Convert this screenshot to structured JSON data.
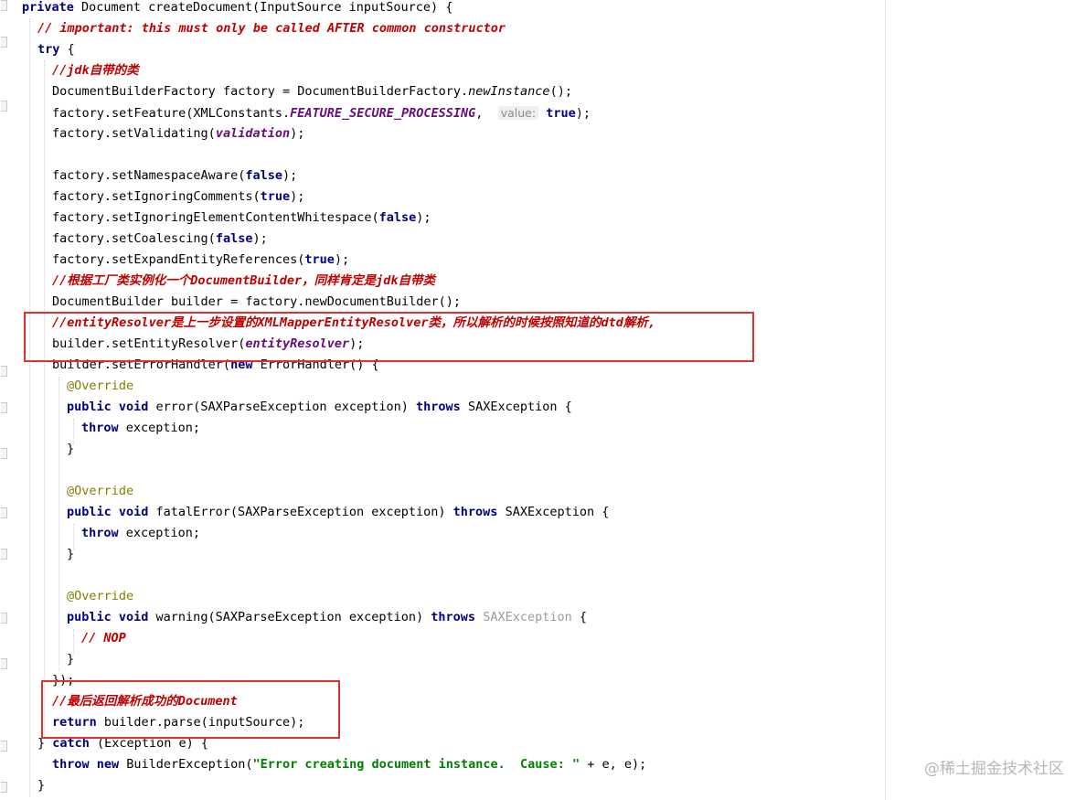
{
  "code_lines": [
    [
      {
        "t": "private ",
        "c": "kw"
      },
      {
        "t": "Document createDocument(InputSource inputSource) {"
      }
    ],
    [
      {
        "t": "// important: this must only be called AFTER common constructor",
        "c": "cm"
      }
    ],
    [
      {
        "t": "try ",
        "c": "kw"
      },
      {
        "t": "{"
      }
    ],
    [
      {
        "t": "//jdk自带的类",
        "c": "cm"
      }
    ],
    [
      {
        "t": "DocumentBuilderFactory factory = DocumentBuilderFactory."
      },
      {
        "t": "newInstance",
        "c": "mth"
      },
      {
        "t": "();"
      }
    ],
    [
      {
        "t": "factory.setFeature(XMLConstants."
      },
      {
        "t": "FEATURE_SECURE_PROCESSING",
        "c": "fld"
      },
      {
        "t": ",  "
      },
      {
        "t": "value:",
        "c": "hint"
      },
      {
        "t": " "
      },
      {
        "t": "true",
        "c": "kw"
      },
      {
        "t": ");"
      }
    ],
    [
      {
        "t": "factory.setValidating("
      },
      {
        "t": "validation",
        "c": "fld"
      },
      {
        "t": ");"
      }
    ],
    [],
    [
      {
        "t": "factory.setNamespaceAware("
      },
      {
        "t": "false",
        "c": "kw"
      },
      {
        "t": ");"
      }
    ],
    [
      {
        "t": "factory.setIgnoringComments("
      },
      {
        "t": "true",
        "c": "kw"
      },
      {
        "t": ");"
      }
    ],
    [
      {
        "t": "factory.setIgnoringElementContentWhitespace("
      },
      {
        "t": "false",
        "c": "kw"
      },
      {
        "t": ");"
      }
    ],
    [
      {
        "t": "factory.setCoalescing("
      },
      {
        "t": "false",
        "c": "kw"
      },
      {
        "t": ");"
      }
    ],
    [
      {
        "t": "factory.setExpandEntityReferences("
      },
      {
        "t": "true",
        "c": "kw"
      },
      {
        "t": ");"
      }
    ],
    [
      {
        "t": "//根据工厂类实例化一个DocumentBuilder，同样肯定是jdk自带类",
        "c": "cm"
      }
    ],
    [
      {
        "t": "DocumentBuilder builder = factory.newDocumentBuilder();"
      }
    ],
    [
      {
        "t": "//entityResolver是上一步设置的XMLMapperEntityResolver类，所以解析的时候按照知道的dtd解析,",
        "c": "cm"
      }
    ],
    [
      {
        "t": "builder.setEntityResolver("
      },
      {
        "t": "entityResolver",
        "c": "fld"
      },
      {
        "t": ");"
      }
    ],
    [
      {
        "t": "builder.setErrorHandler("
      },
      {
        "t": "new ",
        "c": "kw"
      },
      {
        "t": "ErrorHandler() {"
      }
    ],
    [
      {
        "t": "@Override",
        "c": "ann"
      }
    ],
    [
      {
        "t": "public void ",
        "c": "kw"
      },
      {
        "t": "error(SAXParseException exception) "
      },
      {
        "t": "throws ",
        "c": "kw"
      },
      {
        "t": "SAXException {"
      }
    ],
    [
      {
        "t": "throw ",
        "c": "kw"
      },
      {
        "t": "exception;"
      }
    ],
    [
      {
        "t": "}"
      }
    ],
    [],
    [
      {
        "t": "@Override",
        "c": "ann"
      }
    ],
    [
      {
        "t": "public void ",
        "c": "kw"
      },
      {
        "t": "fatalError(SAXParseException exception) "
      },
      {
        "t": "throws ",
        "c": "kw"
      },
      {
        "t": "SAXException {"
      }
    ],
    [
      {
        "t": "throw ",
        "c": "kw"
      },
      {
        "t": "exception;"
      }
    ],
    [
      {
        "t": "}"
      }
    ],
    [],
    [
      {
        "t": "@Override",
        "c": "ann"
      }
    ],
    [
      {
        "t": "public void ",
        "c": "kw"
      },
      {
        "t": "warning(SAXParseException exception) "
      },
      {
        "t": "throws ",
        "c": "kw"
      },
      {
        "t": "SAXException",
        "c": "dim"
      },
      {
        "t": " {"
      }
    ],
    [
      {
        "t": "// NOP",
        "c": "cm"
      }
    ],
    [
      {
        "t": "}"
      }
    ],
    [
      {
        "t": "});"
      }
    ],
    [
      {
        "t": "//最后返回解析成功的Document",
        "c": "cm"
      }
    ],
    [
      {
        "t": "return ",
        "c": "kw"
      },
      {
        "t": "builder.parse(inputSource);"
      }
    ],
    [
      {
        "t": "} "
      },
      {
        "t": "catch ",
        "c": "kw"
      },
      {
        "t": "(Exception e) {"
      }
    ],
    [
      {
        "t": "throw new ",
        "c": "kw"
      },
      {
        "t": "BuilderException("
      },
      {
        "t": "\"Error creating document instance.  Cause: \"",
        "c": "str"
      },
      {
        "t": " + e, e);"
      }
    ],
    [
      {
        "t": "}"
      }
    ]
  ],
  "watermark": "@稀土掘金技术社区"
}
